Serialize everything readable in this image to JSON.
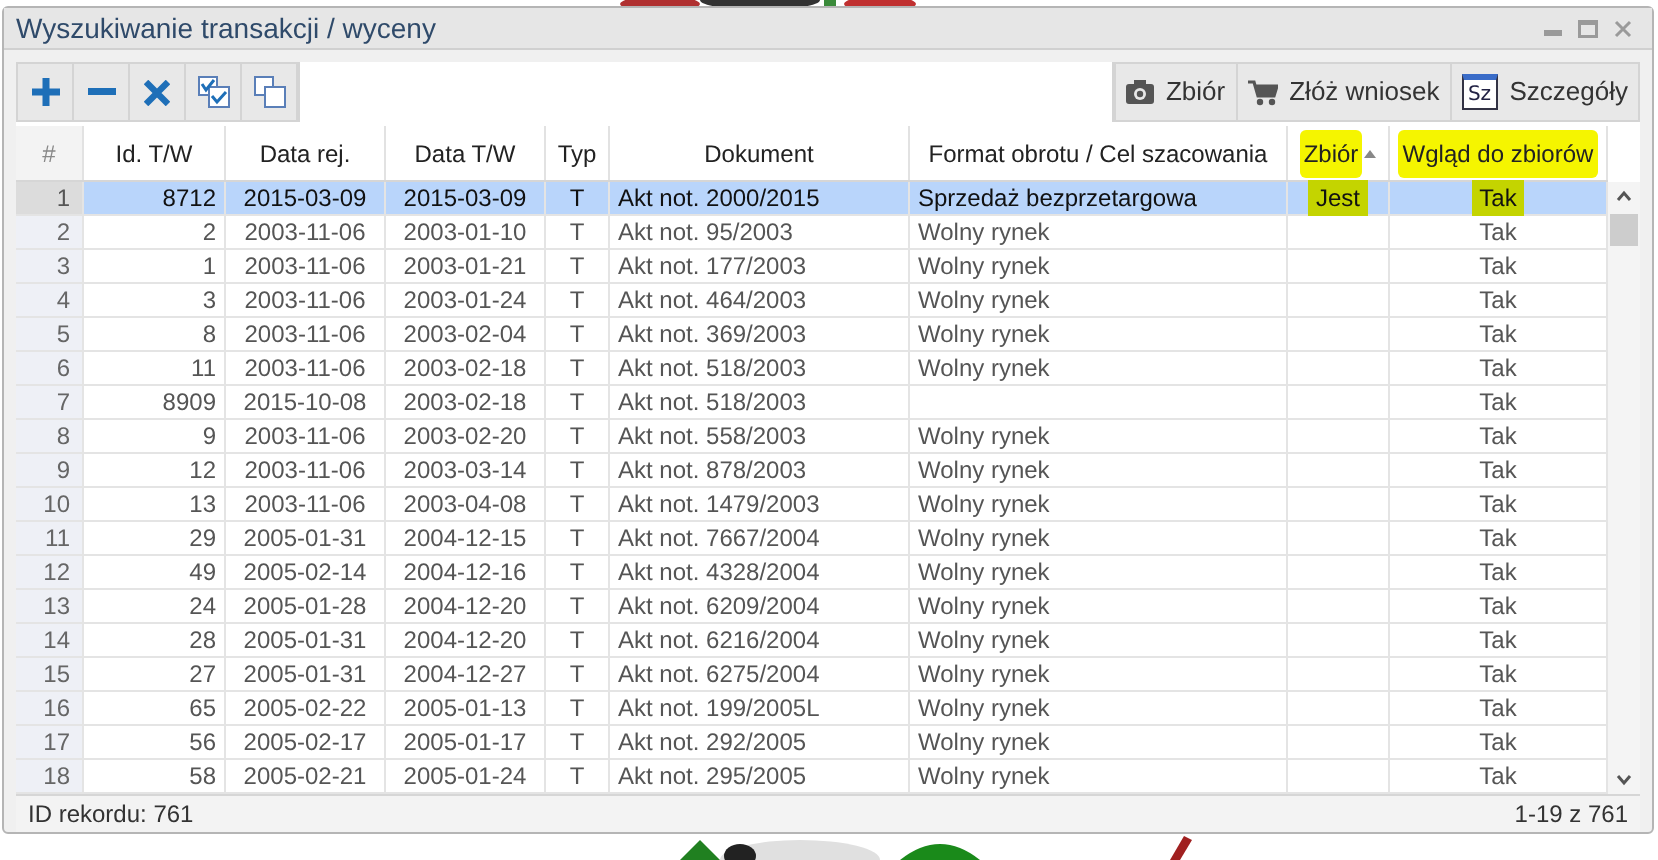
{
  "window": {
    "title": "Wyszukiwanie transakcji / wyceny"
  },
  "toolbar": {
    "left": [
      {
        "kind": "add"
      },
      {
        "kind": "remove"
      },
      {
        "kind": "delete"
      },
      {
        "kind": "select-all"
      },
      {
        "kind": "deselect"
      }
    ],
    "right": [
      {
        "kind": "camera",
        "label": "Zbiór"
      },
      {
        "kind": "cart",
        "label": "Złóż wniosek"
      },
      {
        "kind": "details",
        "label": "Szczegóły",
        "icon_text": "Sz"
      }
    ]
  },
  "table": {
    "columns": [
      {
        "label": "#",
        "highlighted": false
      },
      {
        "label": "Id. T/W",
        "highlighted": false
      },
      {
        "label": "Data rej.",
        "highlighted": false
      },
      {
        "label": "Data T/W",
        "highlighted": false
      },
      {
        "label": "Typ",
        "highlighted": false
      },
      {
        "label": "Dokument",
        "highlighted": false
      },
      {
        "label": "Format obrotu / Cel szacowania",
        "highlighted": false
      },
      {
        "label": "Zbiór",
        "highlighted": true,
        "sorted": true
      },
      {
        "label": "Wgląd do zbiorów",
        "highlighted": true
      }
    ],
    "rows": [
      {
        "selected": true,
        "highlighted": true,
        "number": "1",
        "id": "8712",
        "data_rej": "2015-03-09",
        "data_tw": "2015-03-09",
        "typ": "T",
        "dokument": "Akt not. 2000/2015",
        "format": "Sprzedaż bezprzetargowa",
        "zbior": "Jest",
        "wglad": "Tak"
      },
      {
        "selected": false,
        "highlighted": false,
        "number": "2",
        "id": "2",
        "data_rej": "2003-11-06",
        "data_tw": "2003-01-10",
        "typ": "T",
        "dokument": "Akt not. 95/2003",
        "format": "Wolny rynek",
        "wglad": "Tak"
      },
      {
        "selected": false,
        "highlighted": false,
        "number": "3",
        "id": "1",
        "data_rej": "2003-11-06",
        "data_tw": "2003-01-21",
        "typ": "T",
        "dokument": "Akt not. 177/2003",
        "format": "Wolny rynek",
        "wglad": "Tak"
      },
      {
        "selected": false,
        "highlighted": false,
        "number": "4",
        "id": "3",
        "data_rej": "2003-11-06",
        "data_tw": "2003-01-24",
        "typ": "T",
        "dokument": "Akt not. 464/2003",
        "format": "Wolny rynek",
        "wglad": "Tak"
      },
      {
        "selected": false,
        "highlighted": false,
        "number": "5",
        "id": "8",
        "data_rej": "2003-11-06",
        "data_tw": "2003-02-04",
        "typ": "T",
        "dokument": "Akt not. 369/2003",
        "format": "Wolny rynek",
        "wglad": "Tak"
      },
      {
        "selected": false,
        "highlighted": false,
        "number": "6",
        "id": "11",
        "data_rej": "2003-11-06",
        "data_tw": "2003-02-18",
        "typ": "T",
        "dokument": "Akt not. 518/2003",
        "format": "Wolny rynek",
        "wglad": "Tak"
      },
      {
        "selected": false,
        "highlighted": false,
        "number": "7",
        "id": "8909",
        "data_rej": "2015-10-08",
        "data_tw": "2003-02-18",
        "typ": "T",
        "dokument": "Akt not. 518/2003",
        "wglad": "Tak"
      },
      {
        "selected": false,
        "highlighted": false,
        "number": "8",
        "id": "9",
        "data_rej": "2003-11-06",
        "data_tw": "2003-02-20",
        "typ": "T",
        "dokument": "Akt not. 558/2003",
        "format": "Wolny rynek",
        "wglad": "Tak"
      },
      {
        "selected": false,
        "highlighted": false,
        "number": "9",
        "id": "12",
        "data_rej": "2003-11-06",
        "data_tw": "2003-03-14",
        "typ": "T",
        "dokument": "Akt not. 878/2003",
        "format": "Wolny rynek",
        "wglad": "Tak"
      },
      {
        "selected": false,
        "highlighted": false,
        "number": "10",
        "id": "13",
        "data_rej": "2003-11-06",
        "data_tw": "2003-04-08",
        "typ": "T",
        "dokument": "Akt not. 1479/2003",
        "format": "Wolny rynek",
        "wglad": "Tak"
      },
      {
        "selected": false,
        "highlighted": false,
        "number": "11",
        "id": "29",
        "data_rej": "2005-01-31",
        "data_tw": "2004-12-15",
        "typ": "T",
        "dokument": "Akt not. 7667/2004",
        "format": "Wolny rynek",
        "wglad": "Tak"
      },
      {
        "selected": false,
        "highlighted": false,
        "number": "12",
        "id": "49",
        "data_rej": "2005-02-14",
        "data_tw": "2004-12-16",
        "typ": "T",
        "dokument": "Akt not. 4328/2004",
        "format": "Wolny rynek",
        "wglad": "Tak"
      },
      {
        "selected": false,
        "highlighted": false,
        "number": "13",
        "id": "24",
        "data_rej": "2005-01-28",
        "data_tw": "2004-12-20",
        "typ": "T",
        "dokument": "Akt not. 6209/2004",
        "format": "Wolny rynek",
        "wglad": "Tak"
      },
      {
        "selected": false,
        "highlighted": false,
        "number": "14",
        "id": "28",
        "data_rej": "2005-01-31",
        "data_tw": "2004-12-20",
        "typ": "T",
        "dokument": "Akt not. 6216/2004",
        "format": "Wolny rynek",
        "wglad": "Tak"
      },
      {
        "selected": false,
        "highlighted": false,
        "number": "15",
        "id": "27",
        "data_rej": "2005-01-31",
        "data_tw": "2004-12-27",
        "typ": "T",
        "dokument": "Akt not. 6275/2004",
        "format": "Wolny rynek",
        "wglad": "Tak"
      },
      {
        "selected": false,
        "highlighted": false,
        "number": "16",
        "id": "65",
        "data_rej": "2005-02-22",
        "data_tw": "2005-01-13",
        "typ": "T",
        "dokument": "Akt not. 199/2005L",
        "format": "Wolny rynek",
        "wglad": "Tak"
      },
      {
        "selected": false,
        "highlighted": false,
        "number": "17",
        "id": "56",
        "data_rej": "2005-02-17",
        "data_tw": "2005-01-17",
        "typ": "T",
        "dokument": "Akt not. 292/2005",
        "format": "Wolny rynek",
        "wglad": "Tak"
      },
      {
        "selected": false,
        "highlighted": false,
        "number": "18",
        "id": "58",
        "data_rej": "2005-02-21",
        "data_tw": "2005-01-24",
        "typ": "T",
        "dokument": "Akt not. 295/2005",
        "format": "Wolny rynek",
        "wglad": "Tak"
      }
    ]
  },
  "status_bar": {
    "record_id": "ID rekordu: 761",
    "range": "1-19 z 761"
  }
}
